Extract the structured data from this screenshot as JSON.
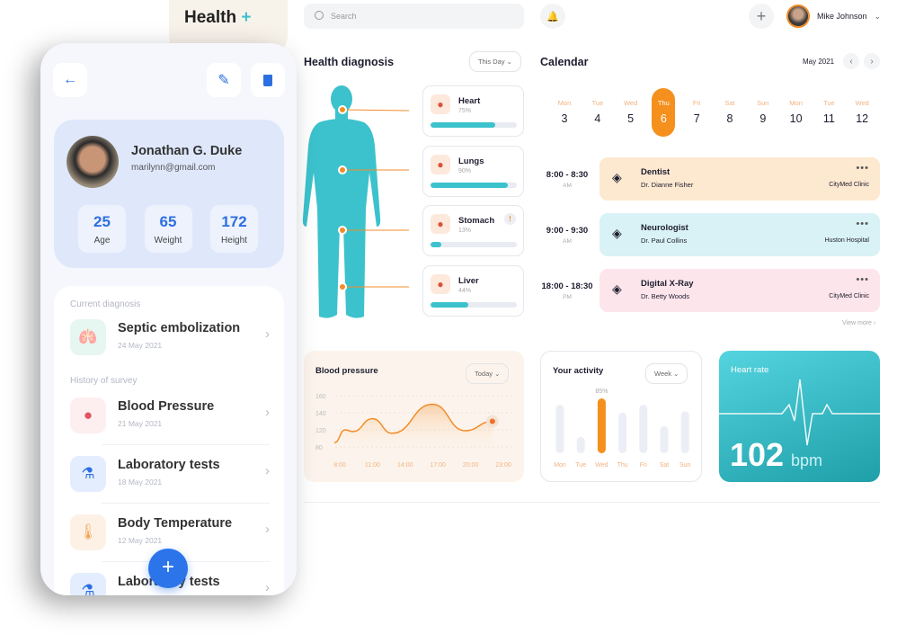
{
  "app": {
    "logo": "Health",
    "logo_plus": "+"
  },
  "header": {
    "search_placeholder": "Search",
    "user_name": "Mike Johnson"
  },
  "diagnosis": {
    "title": "Health diagnosis",
    "filter": "This Day",
    "organs": [
      {
        "name": "Heart",
        "percent": "75%",
        "value": 75,
        "icon": "heart-icon"
      },
      {
        "name": "Lungs",
        "percent": "90%",
        "value": 90,
        "icon": "lungs-icon"
      },
      {
        "name": "Stomach",
        "percent": "13%",
        "value": 13,
        "icon": "stomach-icon",
        "warning": "!"
      },
      {
        "name": "Liver",
        "percent": "44%",
        "value": 44,
        "icon": "liver-icon"
      }
    ]
  },
  "calendar": {
    "title": "Calendar",
    "month": "May 2021",
    "days": [
      {
        "d": "Mon",
        "n": "3"
      },
      {
        "d": "Tue",
        "n": "4"
      },
      {
        "d": "Wed",
        "n": "5"
      },
      {
        "d": "Thu",
        "n": "6",
        "selected": true
      },
      {
        "d": "Fri",
        "n": "7"
      },
      {
        "d": "Sat",
        "n": "8"
      },
      {
        "d": "Sun",
        "n": "9"
      },
      {
        "d": "Mon",
        "n": "10"
      },
      {
        "d": "Tue",
        "n": "11"
      },
      {
        "d": "Wed",
        "n": "12"
      }
    ],
    "appointments": [
      {
        "time": "8:00 - 8:30",
        "ampm": "AM",
        "title": "Dentist",
        "doctor": "Dr. Dianne Fisher",
        "place": "CityMed Clinic",
        "color": "#fde8d0",
        "icon": "tooth-icon"
      },
      {
        "time": "9:00 - 9:30",
        "ampm": "AM",
        "title": "Neurologist",
        "doctor": "Dr. Paul Collins",
        "place": "Huston Hospital",
        "color": "#d9f2f5",
        "icon": "neuron-icon"
      },
      {
        "time": "18:00 - 18:30",
        "ampm": "PM",
        "title": "Digital X-Ray",
        "doctor": "Dr. Betty Woods",
        "place": "CityMed Clinic",
        "color": "#fde5ec",
        "icon": "xray-icon"
      }
    ],
    "view_more": "View more ›",
    "more": "•••"
  },
  "heart_rate": {
    "title": "Heart rate",
    "value": "102",
    "unit": "bpm"
  },
  "phone": {
    "name": "Jonathan G. Duke",
    "email": "marilynn@gmail.com",
    "stats": [
      {
        "value": "25",
        "label": "Age"
      },
      {
        "value": "65",
        "label": "Weight"
      },
      {
        "value": "172",
        "label": "Height"
      }
    ],
    "current_label": "Current diagnosis",
    "current": {
      "title": "Septic embolization",
      "date": "24 May 2021"
    },
    "history_label": "History of survey",
    "history": [
      {
        "title": "Blood Pressure",
        "date": "21 May 2021"
      },
      {
        "title": "Laboratory tests",
        "date": "18 May 2021"
      },
      {
        "title": "Body Temperature",
        "date": "12 May 2021"
      },
      {
        "title": "Laboratory tests",
        "date": ""
      }
    ]
  },
  "chart_data": [
    {
      "type": "line",
      "title": "Blood pressure",
      "filter": "Today",
      "x_ticks": [
        "8:00",
        "11:00",
        "14:00",
        "17:00",
        "20:00",
        "23:00"
      ],
      "y_ticks": [
        80,
        120,
        140,
        160
      ],
      "x_hours": [
        7.5,
        8.5,
        9.2,
        11,
        12.8,
        16.5,
        19.5,
        22
      ],
      "values": [
        90,
        120,
        116,
        133,
        112,
        150,
        118,
        130
      ],
      "color": "#f28c28"
    },
    {
      "type": "bar",
      "title": "Your activity",
      "filter": "Week",
      "categories": [
        "Mon",
        "Tue",
        "Wed",
        "Thu",
        "Fri",
        "Sat",
        "Sun"
      ],
      "values": [
        75,
        25,
        85,
        63,
        75,
        42,
        65
      ],
      "highlight": "Wed",
      "highlight_label": "85%",
      "color": "#f5901f"
    }
  ]
}
